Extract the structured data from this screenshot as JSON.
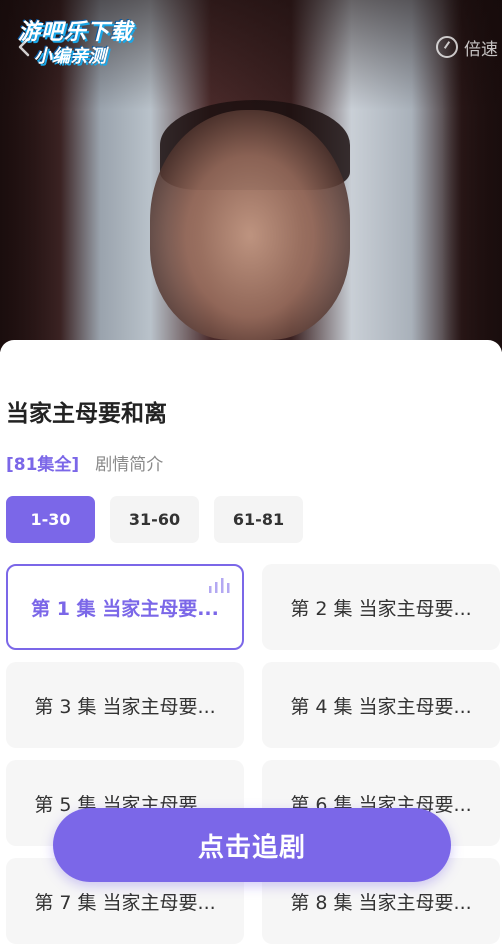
{
  "watermark": {
    "line1": "游吧乐下载",
    "line2": "小编亲测"
  },
  "player": {
    "speed_label": "倍速"
  },
  "drama": {
    "title": "当家主母要和离",
    "episode_count": "[81集全]",
    "intro_link": "剧情简介"
  },
  "ranges": [
    {
      "label": "1-30",
      "active": true
    },
    {
      "label": "31-60",
      "active": false
    },
    {
      "label": "61-81",
      "active": false
    }
  ],
  "episodes": [
    {
      "label": "第 1 集 当家主母要...",
      "active": true
    },
    {
      "label": "第 2 集 当家主母要...",
      "active": false
    },
    {
      "label": "第 3 集 当家主母要...",
      "active": false
    },
    {
      "label": "第 4 集 当家主母要...",
      "active": false
    },
    {
      "label": "第 5 集 当家主母要...",
      "active": false
    },
    {
      "label": "第 6 集 当家主母要...",
      "active": false
    },
    {
      "label": "第 7 集 当家主母要...",
      "active": false
    },
    {
      "label": "第 8 集 当家主母要...",
      "active": false
    }
  ],
  "cta": {
    "label": "点击追剧"
  },
  "colors": {
    "accent": "#7b67e8",
    "tile_bg": "#f6f6f6"
  }
}
